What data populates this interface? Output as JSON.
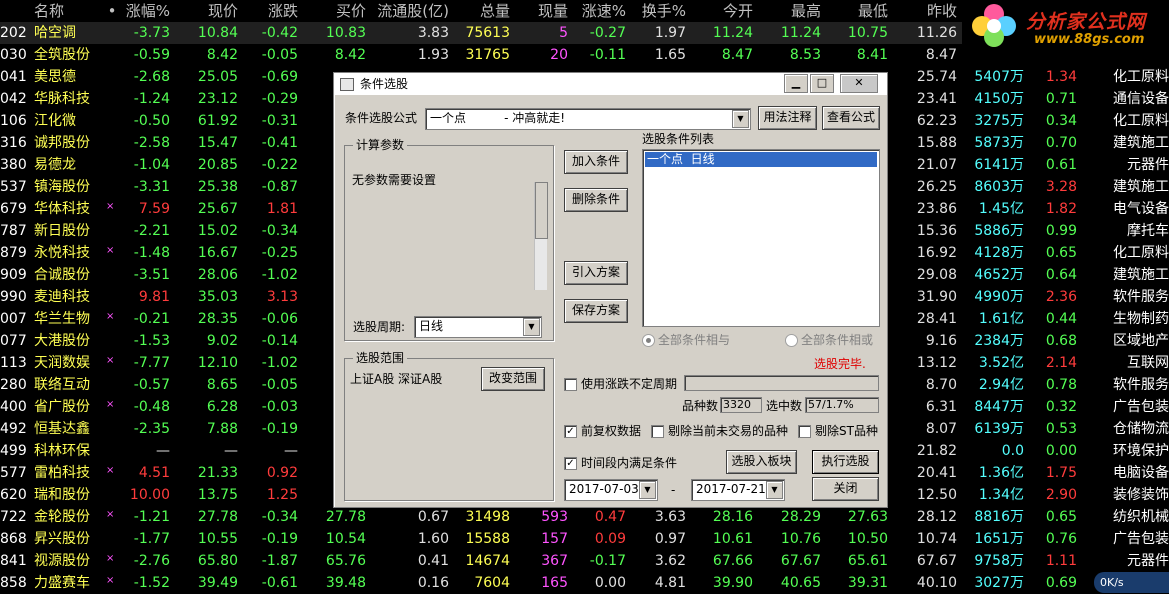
{
  "header": [
    "名称",
    "•",
    "涨幅%",
    "现价",
    "涨跌",
    "买价",
    "流通股(亿)",
    "总量",
    "现量",
    "涨速%",
    "换手%",
    "今开",
    "最高",
    "最低",
    "昨收",
    "",
    "",
    ""
  ],
  "rows": [
    {
      "code": "202",
      "name": "哈空调",
      "mark": "",
      "chg": "-3.73",
      "price": "10.84",
      "diff": "-0.42",
      "bid": "10.83",
      "float": "3.83",
      "vol": "75613",
      "cur": "5",
      "speed": "-0.27",
      "turn": "1.97",
      "open": "11.24",
      "high": "11.24",
      "low": "10.75",
      "prev": "11.26",
      "cap": "",
      "pe": "",
      "ind": ""
    },
    {
      "code": "030",
      "name": "全筑股份",
      "mark": "",
      "chg": "-0.59",
      "price": "8.42",
      "diff": "-0.05",
      "bid": "8.42",
      "float": "1.93",
      "vol": "31765",
      "cur": "20",
      "speed": "-0.11",
      "turn": "1.65",
      "open": "8.47",
      "high": "8.53",
      "low": "8.41",
      "prev": "8.47",
      "cap": "",
      "pe": "",
      "ind": ""
    },
    {
      "code": "041",
      "name": "美思德",
      "mark": "",
      "chg": "-2.68",
      "price": "25.05",
      "diff": "-0.69",
      "prev": "25.74",
      "cap": "5407万",
      "pe": "1.34",
      "ind": "化工原料"
    },
    {
      "code": "042",
      "name": "华脉科技",
      "mark": "",
      "chg": "-1.24",
      "price": "23.12",
      "diff": "-0.29",
      "prev": "23.41",
      "cap": "4150万",
      "pe": "0.71",
      "ind": "通信设备"
    },
    {
      "code": "106",
      "name": "江化微",
      "mark": "",
      "chg": "-0.50",
      "price": "61.92",
      "diff": "-0.31",
      "prev": "62.23",
      "cap": "3275万",
      "pe": "0.34",
      "ind": "化工原料"
    },
    {
      "code": "316",
      "name": "诚邦股份",
      "mark": "",
      "chg": "-2.58",
      "price": "15.47",
      "diff": "-0.41",
      "prev": "15.88",
      "cap": "5873万",
      "pe": "0.70",
      "ind": "建筑施工"
    },
    {
      "code": "380",
      "name": "易德龙",
      "mark": "",
      "chg": "-1.04",
      "price": "20.85",
      "diff": "-0.22",
      "prev": "21.07",
      "cap": "6141万",
      "pe": "0.61",
      "ind": "元器件"
    },
    {
      "code": "537",
      "name": "镇海股份",
      "mark": "",
      "chg": "-3.31",
      "price": "25.38",
      "diff": "-0.87",
      "prev": "26.25",
      "cap": "8603万",
      "pe": "3.28",
      "ind": "建筑施工"
    },
    {
      "code": "679",
      "name": "华体科技",
      "mark": "×",
      "chg": "7.59",
      "price": "25.67",
      "diff": "1.81",
      "prev": "23.86",
      "cap": "1.45亿",
      "pe": "1.82",
      "ind": "电气设备"
    },
    {
      "code": "787",
      "name": "新日股份",
      "mark": "",
      "chg": "-2.21",
      "price": "15.02",
      "diff": "-0.34",
      "prev": "15.36",
      "cap": "5886万",
      "pe": "0.99",
      "ind": "摩托车"
    },
    {
      "code": "879",
      "name": "永悦科技",
      "mark": "×",
      "chg": "-1.48",
      "price": "16.67",
      "diff": "-0.25",
      "prev": "16.92",
      "cap": "4128万",
      "pe": "0.65",
      "ind": "化工原料"
    },
    {
      "code": "909",
      "name": "合诚股份",
      "mark": "",
      "chg": "-3.51",
      "price": "28.06",
      "diff": "-1.02",
      "prev": "29.08",
      "cap": "4652万",
      "pe": "0.64",
      "ind": "建筑施工"
    },
    {
      "code": "990",
      "name": "麦迪科技",
      "mark": "",
      "chg": "9.81",
      "price": "35.03",
      "diff": "3.13",
      "prev": "31.90",
      "cap": "4990万",
      "pe": "2.36",
      "ind": "软件服务"
    },
    {
      "code": "007",
      "name": "华兰生物",
      "mark": "×",
      "chg": "-0.21",
      "price": "28.35",
      "diff": "-0.06",
      "prev": "28.41",
      "cap": "1.61亿",
      "pe": "0.44",
      "ind": "生物制药"
    },
    {
      "code": "077",
      "name": "大港股份",
      "mark": "",
      "chg": "-1.53",
      "price": "9.02",
      "diff": "-0.14",
      "prev": "9.16",
      "cap": "2384万",
      "pe": "0.68",
      "ind": "区域地产"
    },
    {
      "code": "113",
      "name": "天润数娱",
      "mark": "×",
      "chg": "-7.77",
      "price": "12.10",
      "diff": "-1.02",
      "prev": "13.12",
      "cap": "3.52亿",
      "pe": "2.14",
      "ind": "互联网"
    },
    {
      "code": "280",
      "name": "联络互动",
      "mark": "",
      "chg": "-0.57",
      "price": "8.65",
      "diff": "-0.05",
      "prev": "8.70",
      "cap": "2.94亿",
      "pe": "0.78",
      "ind": "软件服务"
    },
    {
      "code": "400",
      "name": "省广股份",
      "mark": "×",
      "chg": "-0.48",
      "price": "6.28",
      "diff": "-0.03",
      "prev": "6.31",
      "cap": "8447万",
      "pe": "0.32",
      "ind": "广告包装"
    },
    {
      "code": "492",
      "name": "恒基达鑫",
      "mark": "",
      "chg": "-2.35",
      "price": "7.88",
      "diff": "-0.19",
      "prev": "8.07",
      "cap": "6139万",
      "pe": "0.53",
      "ind": "仓储物流"
    },
    {
      "code": "499",
      "name": "科林环保",
      "mark": "",
      "chg": "—",
      "price": "—",
      "diff": "—",
      "prev": "21.82",
      "cap": "0.0",
      "pe": "0.00",
      "ind": "环境保护"
    },
    {
      "code": "577",
      "name": "雷柏科技",
      "mark": "×",
      "chg": "4.51",
      "price": "21.33",
      "diff": "0.92",
      "prev": "20.41",
      "cap": "1.36亿",
      "pe": "1.75",
      "ind": "电脑设备"
    },
    {
      "code": "620",
      "name": "瑞和股份",
      "mark": "",
      "chg": "10.00",
      "price": "13.75",
      "diff": "1.25",
      "prev": "12.50",
      "cap": "1.34亿",
      "pe": "2.90",
      "ind": "装修装饰"
    },
    {
      "code": "722",
      "name": "金轮股份",
      "mark": "×",
      "chg": "-1.21",
      "price": "27.78",
      "diff": "-0.34",
      "bid": "27.78",
      "float": "0.67",
      "vol": "31498",
      "cur": "593",
      "speed": "0.47",
      "turn": "3.63",
      "open": "28.16",
      "high": "28.29",
      "low": "27.63",
      "prev": "28.12",
      "cap": "8816万",
      "pe": "0.65",
      "ind": "纺织机械"
    },
    {
      "code": "868",
      "name": "昇兴股份",
      "mark": "",
      "chg": "-1.77",
      "price": "10.55",
      "diff": "-0.19",
      "bid": "10.54",
      "float": "1.60",
      "vol": "15588",
      "cur": "157",
      "speed": "0.09",
      "turn": "0.97",
      "open": "10.61",
      "high": "10.76",
      "low": "10.50",
      "prev": "10.74",
      "cap": "1651万",
      "pe": "0.76",
      "ind": "广告包装"
    },
    {
      "code": "841",
      "name": "视源股份",
      "mark": "×",
      "chg": "-2.76",
      "price": "65.80",
      "diff": "-1.87",
      "bid": "65.76",
      "float": "0.41",
      "vol": "14674",
      "cur": "367",
      "speed": "-0.17",
      "turn": "3.62",
      "open": "67.66",
      "high": "67.67",
      "low": "65.61",
      "prev": "67.67",
      "cap": "9758万",
      "pe": "1.11",
      "ind": "元器件"
    },
    {
      "code": "858",
      "name": "力盛赛车",
      "mark": "×",
      "chg": "-1.52",
      "price": "39.49",
      "diff": "-0.61",
      "bid": "39.48",
      "float": "0.16",
      "vol": "7604",
      "cur": "165",
      "speed": "0.00",
      "turn": "4.81",
      "open": "39.90",
      "high": "40.65",
      "low": "39.31",
      "prev": "40.10",
      "cap": "3027万",
      "pe": "0.69",
      "ind": ""
    }
  ],
  "logo": {
    "text": "分析家公式网",
    "url": "www.88gs.com"
  },
  "net_badge": "0K/s",
  "dialog": {
    "title": "条件选股",
    "formula_label": "条件选股公式",
    "formula_value": "一个点          - 冲高就走!",
    "btn_usage": "用法注释",
    "btn_view": "查看公式",
    "calc_group": "计算参数",
    "calc_text": "无参数需要设置",
    "period_label": "选股周期:",
    "period_value": "日线",
    "btn_add": "加入条件",
    "btn_del": "删除条件",
    "btn_import": "引入方案",
    "btn_save": "保存方案",
    "list_label": "选股条件列表",
    "list_items": [
      "一个点  日线"
    ],
    "radio_and": "全部条件相与",
    "radio_or": "全部条件相或",
    "done": "选股完毕.",
    "range_group": "选股范围",
    "range_text": "上证A股  深证A股",
    "btn_range": "改变范围",
    "chk_uncertain": "使用涨跌不定周期",
    "count_label": "品种数",
    "count_value": "3320",
    "selected_label": "选中数",
    "selected_value": "57/1.7%",
    "chk_prefq": "前复权数据",
    "chk_exclude_notrade": "剔除当前未交易的品种",
    "chk_exclude_st": "剔除ST品种",
    "chk_timerange": "时间段内满足条件",
    "btn_to_block": "选股入板块",
    "btn_exec": "执行选股",
    "date_from": "2017-07-03",
    "date_sep": "-",
    "date_to": "2017-07-21",
    "btn_close": "关闭",
    "chk_states": {
      "uncertain": false,
      "prefq": true,
      "exclude_notrade": false,
      "exclude_st": false,
      "timerange": true
    }
  }
}
